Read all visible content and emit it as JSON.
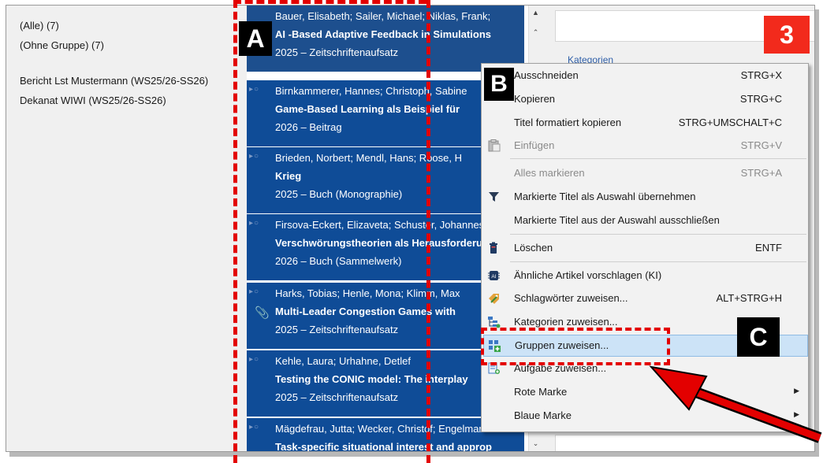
{
  "groups": {
    "items": [
      {
        "label": "(Alle) (7)"
      },
      {
        "label": "(Ohne Gruppe) (7)"
      },
      {
        "label": "Bericht Lst Mustermann (WS25/26-SS26)"
      },
      {
        "label": "Dekanat WIWI (WS25/26-SS26)"
      }
    ]
  },
  "entries": [
    {
      "authors": "Bauer, Elisabeth; Sailer, Michael; Niklas, Frank;",
      "title": "AI -Based Adaptive Feedback in Simulations",
      "meta": "2025 – Zeitschriftenaufsatz"
    },
    {
      "authors": "Birnkammerer, Hannes; Christoph, Sabine",
      "title": "Game-Based Learning als Beispiel für",
      "meta": "2026 – Beitrag"
    },
    {
      "authors": "Brieden, Norbert; Mendl, Hans; Roose, H",
      "title": "Krieg",
      "meta": "2025 – Buch (Monographie)"
    },
    {
      "authors": "Firsova-Eckert, Elizaveta; Schuster, Johannes",
      "title": "Verschwörungstheorien als Herausforderung",
      "meta": "2026 – Buch (Sammelwerk)"
    },
    {
      "authors": "Harks, Tobias; Henle, Mona; Klimm, Max",
      "title": "Multi-Leader Congestion Games with",
      "meta": "2025 – Zeitschriftenaufsatz"
    },
    {
      "authors": "Kehle, Laura; Urhahne, Detlef",
      "title": "Testing the CONIC model: The interplay",
      "meta": "2025 – Zeitschriftenaufsatz"
    },
    {
      "authors": "Mägdefrau, Jutta; Wecker, Christof; Engelmann",
      "title": "Task-specific situational interest and approp",
      "meta": ""
    }
  ],
  "detail": {
    "kategorien_label": "Kategorien"
  },
  "menu": {
    "items": [
      {
        "label": "Ausschneiden",
        "shortcut": "STRG+X"
      },
      {
        "label": "Kopieren",
        "shortcut": "STRG+C"
      },
      {
        "label": "Titel formatiert kopieren",
        "shortcut": "STRG+UMSCHALT+C"
      },
      {
        "label": "Einfügen",
        "shortcut": "STRG+V"
      },
      {
        "label": "Alles markieren",
        "shortcut": "STRG+A"
      },
      {
        "label": "Markierte Titel als Auswahl übernehmen",
        "shortcut": ""
      },
      {
        "label": "Markierte Titel aus der Auswahl ausschließen",
        "shortcut": ""
      },
      {
        "label": "Löschen",
        "shortcut": "ENTF"
      },
      {
        "label": "Ähnliche Artikel vorschlagen (KI)",
        "shortcut": ""
      },
      {
        "label": "Schlagwörter zuweisen...",
        "shortcut": "ALT+STRG+H"
      },
      {
        "label": "Kategorien zuweisen...",
        "shortcut": ""
      },
      {
        "label": "Gruppen zuweisen...",
        "shortcut": ""
      },
      {
        "label": "Aufgabe zuweisen...",
        "shortcut": ""
      },
      {
        "label": "Rote Marke",
        "shortcut": ""
      },
      {
        "label": "Blaue Marke",
        "shortcut": ""
      }
    ]
  },
  "annotations": {
    "a": "A",
    "b": "B",
    "c": "C",
    "step": "3"
  },
  "colors": {
    "selection": "#0f4c97",
    "highlight": "#cce3f7",
    "annotation_red": "#e30000",
    "step_badge": "#f22a1c"
  }
}
